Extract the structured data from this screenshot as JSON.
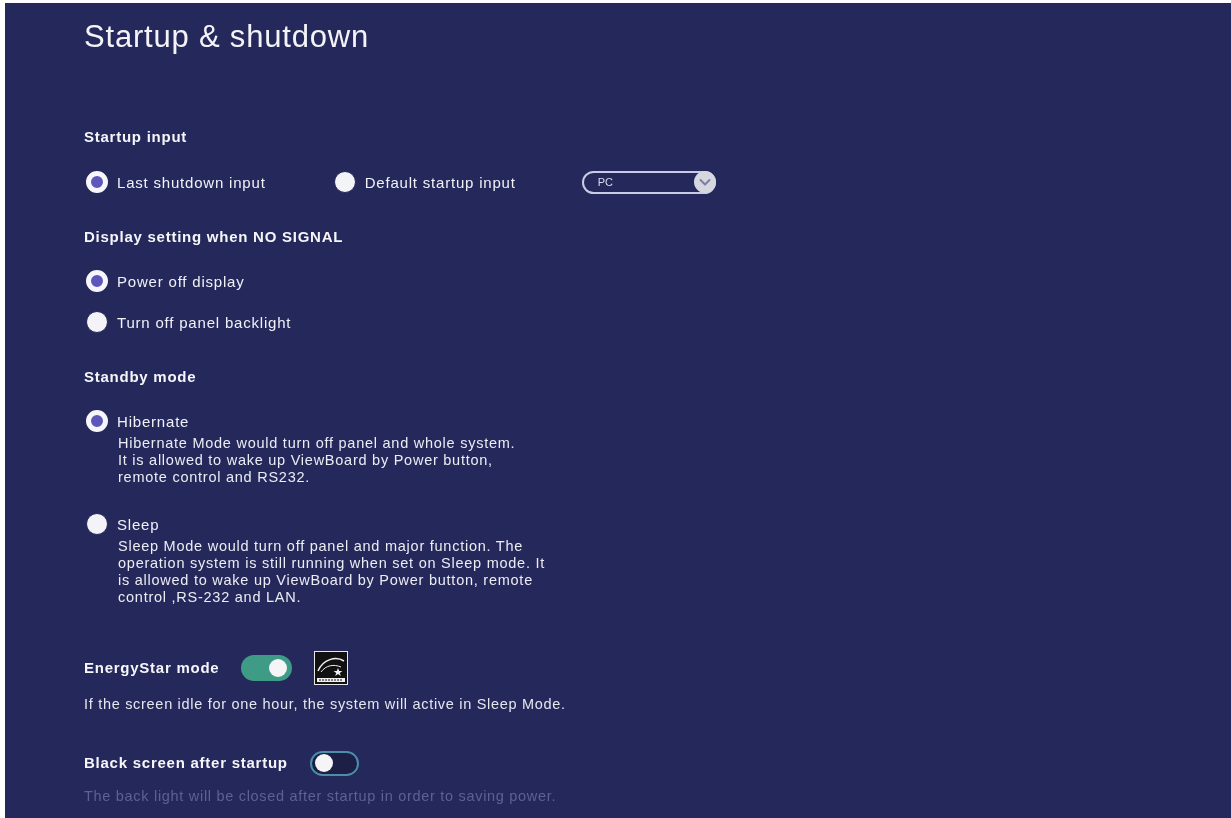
{
  "title": "Startup & shutdown",
  "sections": [
    {
      "kind": "radio_row",
      "heading": "Startup input",
      "options": [
        {
          "label": "Last shutdown input",
          "selected": true
        },
        {
          "label": "Default startup input",
          "selected": false
        }
      ],
      "dropdown": {
        "value": "PC"
      }
    },
    {
      "kind": "radio_list",
      "heading": "Display setting when NO SIGNAL",
      "options": [
        {
          "label": "Power off display",
          "selected": true
        },
        {
          "label": "Turn off panel backlight",
          "selected": false
        }
      ]
    },
    {
      "kind": "radio_list",
      "heading": "Standby mode",
      "options": [
        {
          "label": "Hibernate",
          "selected": true,
          "description": "Hibernate Mode would turn off panel and whole system.\nIt is allowed to wake up ViewBoard by Power button,\nremote control and RS232."
        },
        {
          "label": "Sleep",
          "selected": false,
          "description": "Sleep Mode would turn off panel and major function. The\noperation system is still running when set on Sleep mode. It\nis allowed to wake up ViewBoard by Power button, remote\ncontrol ,RS-232 and LAN."
        }
      ]
    },
    {
      "kind": "toggle",
      "heading": "EnergyStar mode",
      "on": true,
      "logo": true,
      "description": "If the screen idle for one hour, the system will active in Sleep Mode."
    },
    {
      "kind": "toggle",
      "heading": "Black screen after startup",
      "on": false,
      "description": "The back light will be closed after startup in order to saving power."
    }
  ]
}
